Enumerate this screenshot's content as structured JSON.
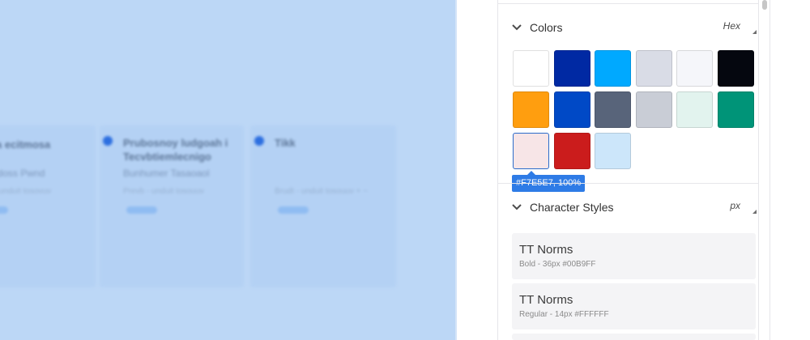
{
  "canvas": {
    "cards": [
      {
        "title": "ra ecitmosa",
        "subtitle": "adoss Pwnd",
        "meta": "~ unduit tosovuv",
        "badge": ""
      },
      {
        "title": "Prubosnoy ludgoah i",
        "title2": "Tecvbtiemlecnigo",
        "subtitle": "Bunhumer Tasaoaol",
        "meta": "Prevb - unduit tosouuv",
        "badge": ""
      },
      {
        "title": "Tikk",
        "subtitle": "",
        "meta": "Brudt - unduit tosouuv + ~",
        "badge": ""
      }
    ]
  },
  "colors_section": {
    "title": "Colors",
    "unit": "Hex",
    "swatches": [
      "#FFFFFF",
      "#0029A3",
      "#00A9FF",
      "#D9DCE6",
      "#F5F6FA",
      "#05070F",
      "#FF9E0F",
      "#0049C6",
      "#58647A",
      "#C9CDD6",
      "#E2F3EE",
      "#009478",
      "#F7E5E7",
      "#CB1C1C",
      "#CCE6FA"
    ],
    "selected_index": 12,
    "tooltip": "#F7E5E7, 100%"
  },
  "character_styles_section": {
    "title": "Character Styles",
    "unit": "px",
    "styles": [
      {
        "name": "TT Norms",
        "desc": "Bold - 36px #00B9FF"
      },
      {
        "name": "TT Norms",
        "desc": "Regular - 14px #FFFFFF"
      }
    ]
  },
  "icons": {
    "colors_chevron": "chevron-down-icon",
    "styles_chevron": "chevron-down-icon"
  }
}
